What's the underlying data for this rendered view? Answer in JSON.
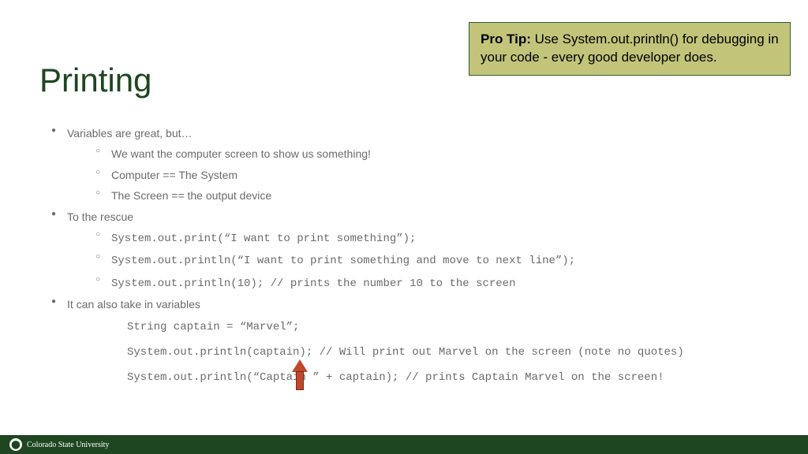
{
  "title": "Printing",
  "pro_tip": {
    "label": "Pro Tip:",
    "text": "Use System.out.println() for debugging in your code - every good developer does."
  },
  "bullets": {
    "b1": "Variables are great, but…",
    "b1_1": "We want the computer screen to show us something!",
    "b1_2": "Computer == The System",
    "b1_3": "The Screen == the output device",
    "b2": "To the rescue",
    "b2_1": "System.out.print(“I want to print something”);",
    "b2_2": "System.out.println(“I want to print something and move to next line”);",
    "b2_3": "System.out.println(10);  // prints the number 10 to the  screen",
    "b3": "It can also take in variables",
    "code1": "String captain = “Marvel”;",
    "code2": "System.out.println(captain);  // Will print out Marvel on the screen (note no quotes)",
    "code3": "System.out.println(“Captain ” + captain); // prints Captain Marvel on the screen!"
  },
  "footer": {
    "org": "Colorado State University"
  }
}
